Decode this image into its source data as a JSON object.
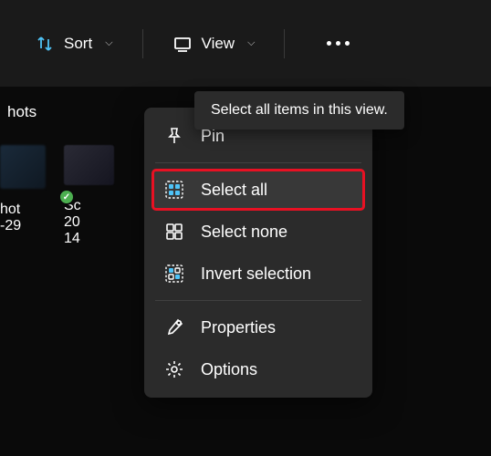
{
  "toolbar": {
    "sort_label": "Sort",
    "view_label": "View"
  },
  "breadcrumb": "hots",
  "thumbnails": {
    "item1": {
      "label": "hot",
      "sublabel": "-29"
    },
    "item2": {
      "label": "Sc",
      "line2": "20",
      "line3": "14"
    }
  },
  "menu": {
    "pin": "Pin",
    "select_all": "Select all",
    "select_none": "Select none",
    "invert_selection": "Invert selection",
    "properties": "Properties",
    "options": "Options"
  },
  "tooltip": "Select all items in this view."
}
